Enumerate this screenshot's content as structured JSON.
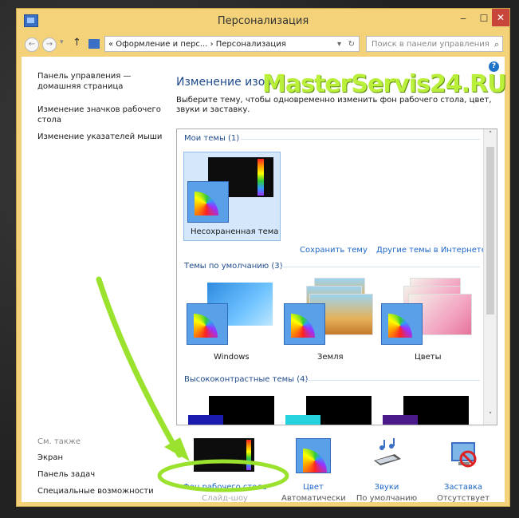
{
  "window": {
    "title": "Персонализация",
    "min_label": "‒",
    "max_label": "☐",
    "close_label": "✕"
  },
  "nav": {
    "back": "←",
    "forward": "→",
    "recent": "▾",
    "up": "↑",
    "address": "« Оформление и перс... › Персонализация",
    "address_dropdown": "▾",
    "refresh": "↻",
    "search_placeholder": "Поиск в панели управления",
    "search_icon": "⌕"
  },
  "sidebar": {
    "home_link": "Панель управления — домашняя страница",
    "links": [
      "Изменение значков рабочего стола",
      "Изменение указателей мыши"
    ],
    "see_also": "См. также",
    "see_also_links": [
      "Экран",
      "Панель задач",
      "Специальные возможности"
    ]
  },
  "main": {
    "heading": "Изменение изоб",
    "watermark": "MasterServis24.RU",
    "description": "Выберите тему, чтобы одновременно изменить фон рабочего стола, цвет, звуки и заставку.",
    "help": "?"
  },
  "themes": {
    "my_group": "Мои темы (1)",
    "unsaved_theme": "Несохраненная тема",
    "save_theme": "Сохранить тему",
    "online_themes": "Другие темы в Интернете",
    "default_group": "Темы по умолчанию (3)",
    "default_items": [
      "Windows",
      "Земля",
      "Цветы"
    ],
    "hc_group": "Высококонтрастные темы (4)",
    "scroll_up": "˄",
    "scroll_down": "˅"
  },
  "bottom": {
    "background": {
      "name": "Фон рабочего стола",
      "sub": "Слайд-шоу"
    },
    "color": {
      "name": "Цвет",
      "sub": "Автоматически"
    },
    "sounds": {
      "name": "Звуки",
      "sub": "По умолчанию"
    },
    "screensaver": {
      "name": "Заставка",
      "sub": "Отсутствует"
    }
  },
  "colors": {
    "accent": "#1e66c7",
    "frame": "#f3d27a",
    "close": "#c7453a",
    "annotation": "#9be22e"
  }
}
